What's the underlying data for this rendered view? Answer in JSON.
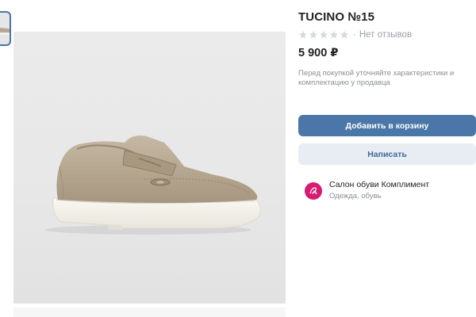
{
  "product": {
    "title": "TUCINO №15",
    "reviews_text": "Нет отзывов",
    "rating": 0,
    "rating_max": 5,
    "price": "5 900 ₽",
    "note": "Перед покупкой уточняйте характеристики и комплектацию у продавца"
  },
  "actions": {
    "add_to_cart": "Добавить в корзину",
    "message": "Написать"
  },
  "seller": {
    "name": "Салон обуви Комплимент",
    "category": "Одежда, обувь"
  },
  "colors": {
    "accent": "#4a76a8",
    "secondary_bg": "#e8edf3",
    "avatar": "#d81b72",
    "star_empty": "#d5d9de"
  }
}
